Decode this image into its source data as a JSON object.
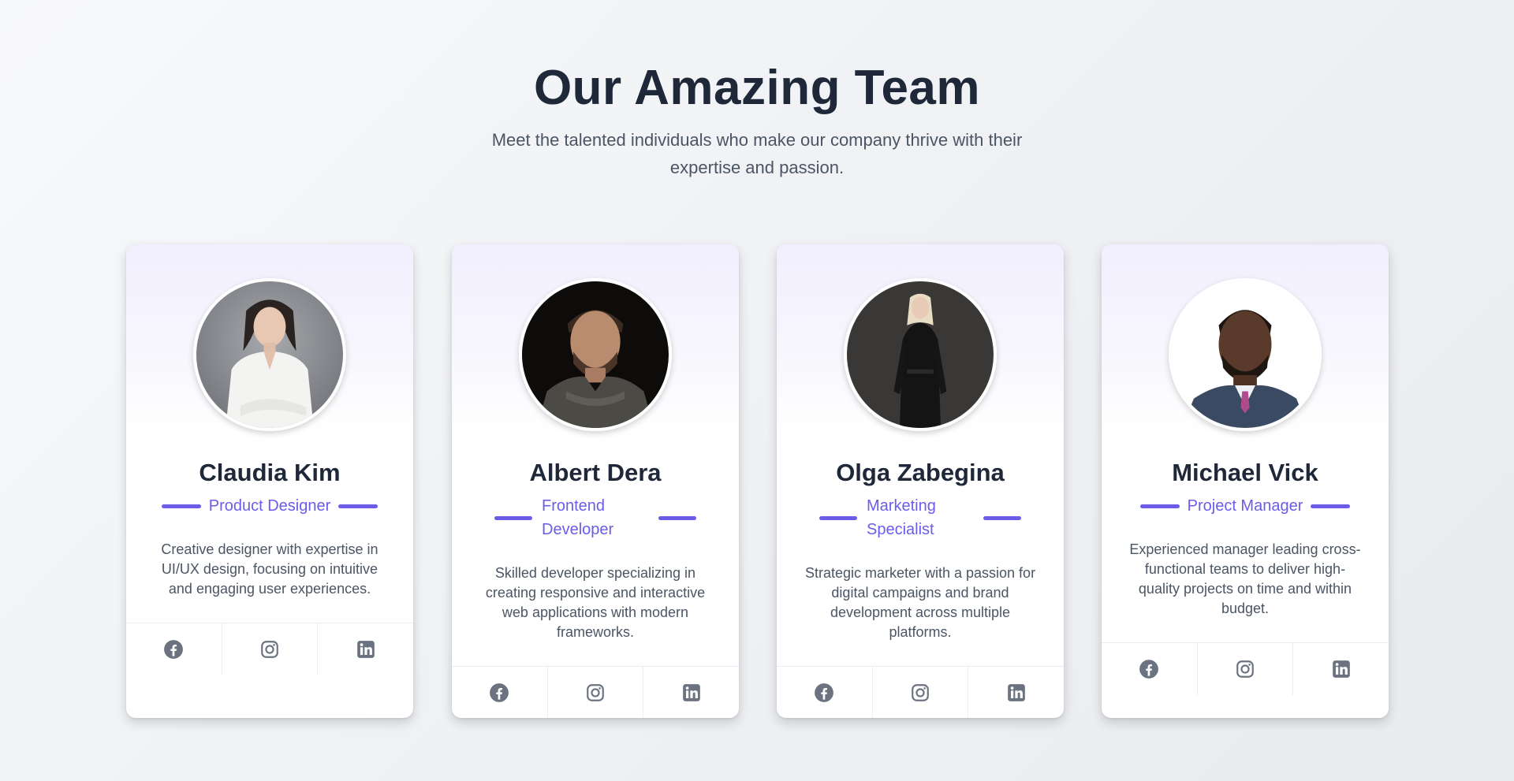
{
  "header": {
    "title": "Our Amazing Team",
    "subtitle": "Meet the talented individuals who make our company thrive with their expertise and passion."
  },
  "colors": {
    "accent": "#6c5ce7",
    "heading": "#1e2839",
    "body_text": "#4b5563",
    "icon": "#6b7280"
  },
  "team": [
    {
      "name": "Claudia Kim",
      "role": "Product Designer",
      "description": "Creative designer with expertise in UI/UX design, focusing on intuitive and engaging user experiences.",
      "avatar": "woman-white-shirt-photo",
      "social": [
        "facebook-icon",
        "instagram-icon",
        "linkedin-icon"
      ]
    },
    {
      "name": "Albert Dera",
      "role": "Frontend Developer",
      "description": "Skilled developer specializing in creating responsive and interactive web applications with modern frameworks.",
      "avatar": "man-knit-sweater-photo",
      "social": [
        "facebook-icon",
        "instagram-icon",
        "linkedin-icon"
      ]
    },
    {
      "name": "Olga Zabegina",
      "role": "Marketing Specialist",
      "description": "Strategic marketer with a passion for digital campaigns and brand development across multiple platforms.",
      "avatar": "woman-black-suit-photo",
      "social": [
        "facebook-icon",
        "instagram-icon",
        "linkedin-icon"
      ]
    },
    {
      "name": "Michael Vick",
      "role": "Project Manager",
      "description": "Experienced manager leading cross-functional teams to deliver high-quality projects on time and within budget.",
      "avatar": "man-suit-tie-photo",
      "social": [
        "facebook-icon",
        "instagram-icon",
        "linkedin-icon"
      ]
    }
  ]
}
